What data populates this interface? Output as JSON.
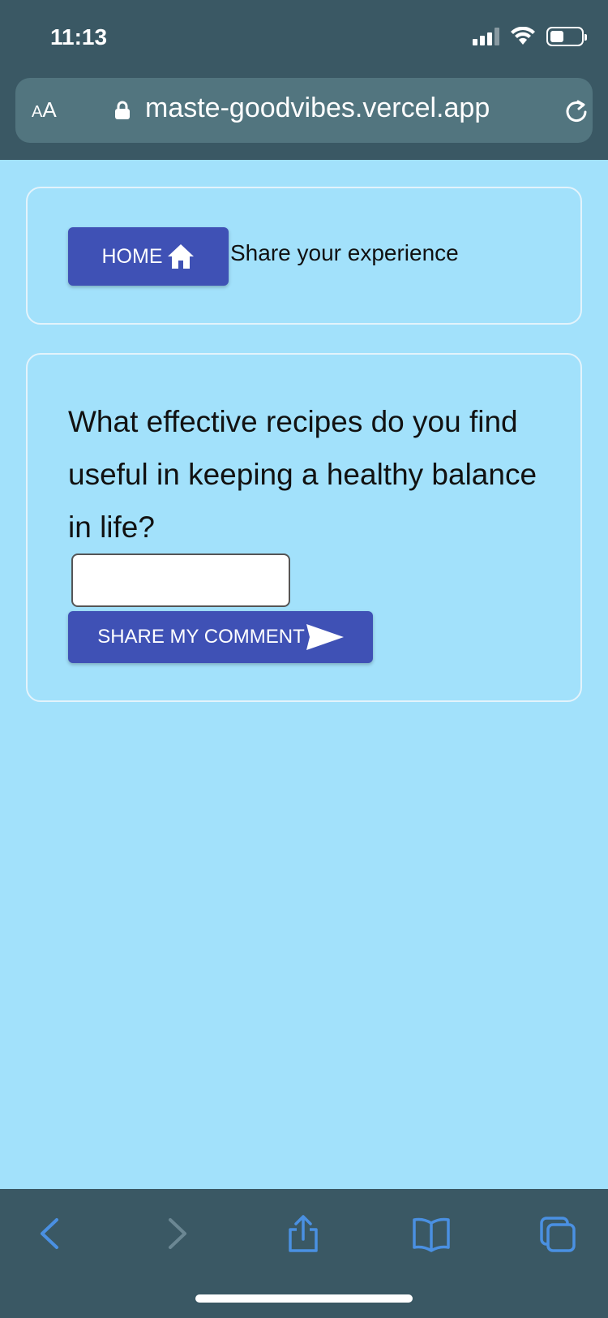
{
  "status_bar": {
    "time": "11:13"
  },
  "browser": {
    "text_size_label_small": "A",
    "text_size_label_large": "A",
    "url": "maste-goodvibes.vercel.app"
  },
  "header": {
    "home_label": "HOME",
    "title": "Share your experience"
  },
  "main": {
    "question": "What effective recipes do you find useful in keeping a healthy balance in life?",
    "comment_input_value": "",
    "share_label": "SHARE MY COMMENT"
  },
  "colors": {
    "background": "#a2e1fb",
    "chrome": "#3a5864",
    "button": "#3f51b5",
    "toolbar_icon": "#4a90e2"
  }
}
